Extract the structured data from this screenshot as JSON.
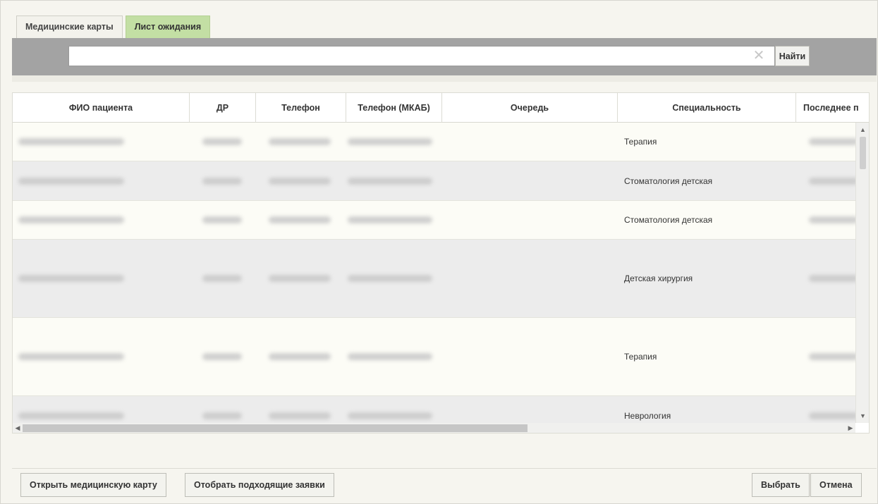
{
  "tabs": [
    {
      "label": "Медицинские карты",
      "active": false
    },
    {
      "label": "Лист ожидания",
      "active": true
    }
  ],
  "search": {
    "value": "",
    "placeholder": "",
    "clear_icon": "✕",
    "button_label": "Найти"
  },
  "table": {
    "columns": [
      "ФИО пациента",
      "ДР",
      "Телефон",
      "Телефон (МКАБ)",
      "Очередь",
      "Специальность",
      "Последнее п"
    ],
    "rows": [
      {
        "specialty": "Терапия"
      },
      {
        "specialty": "Стоматология детская"
      },
      {
        "specialty": "Стоматология детская"
      },
      {
        "specialty": "Детская хирургия"
      },
      {
        "specialty": "Терапия"
      },
      {
        "specialty": "Неврология"
      }
    ]
  },
  "footer": {
    "open_card_label": "Открыть медицинскую карту",
    "select_requests_label": "Отобрать подходящие заявки",
    "choose_label": "Выбрать",
    "cancel_label": "Отмена"
  },
  "scroll": {
    "up_icon": "▲",
    "down_icon": "▼",
    "left_icon": "◀",
    "right_icon": "▶"
  }
}
